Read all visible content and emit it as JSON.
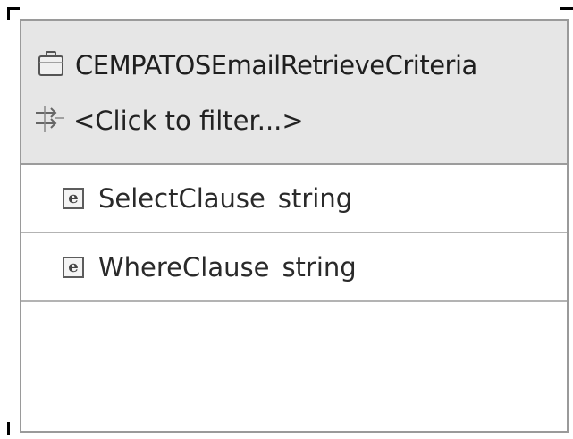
{
  "business_object": {
    "title": "CEMPATOSEmailRetrieveCriteria",
    "icon": "briefcase-icon",
    "filter_placeholder": "<Click to filter...>",
    "filter_icon": "filter-icon"
  },
  "fields": [
    {
      "icon": "element-icon",
      "icon_letter": "e",
      "name": "SelectClause",
      "type": "string"
    },
    {
      "icon": "element-icon",
      "icon_letter": "e",
      "name": "WhereClause",
      "type": "string"
    }
  ]
}
